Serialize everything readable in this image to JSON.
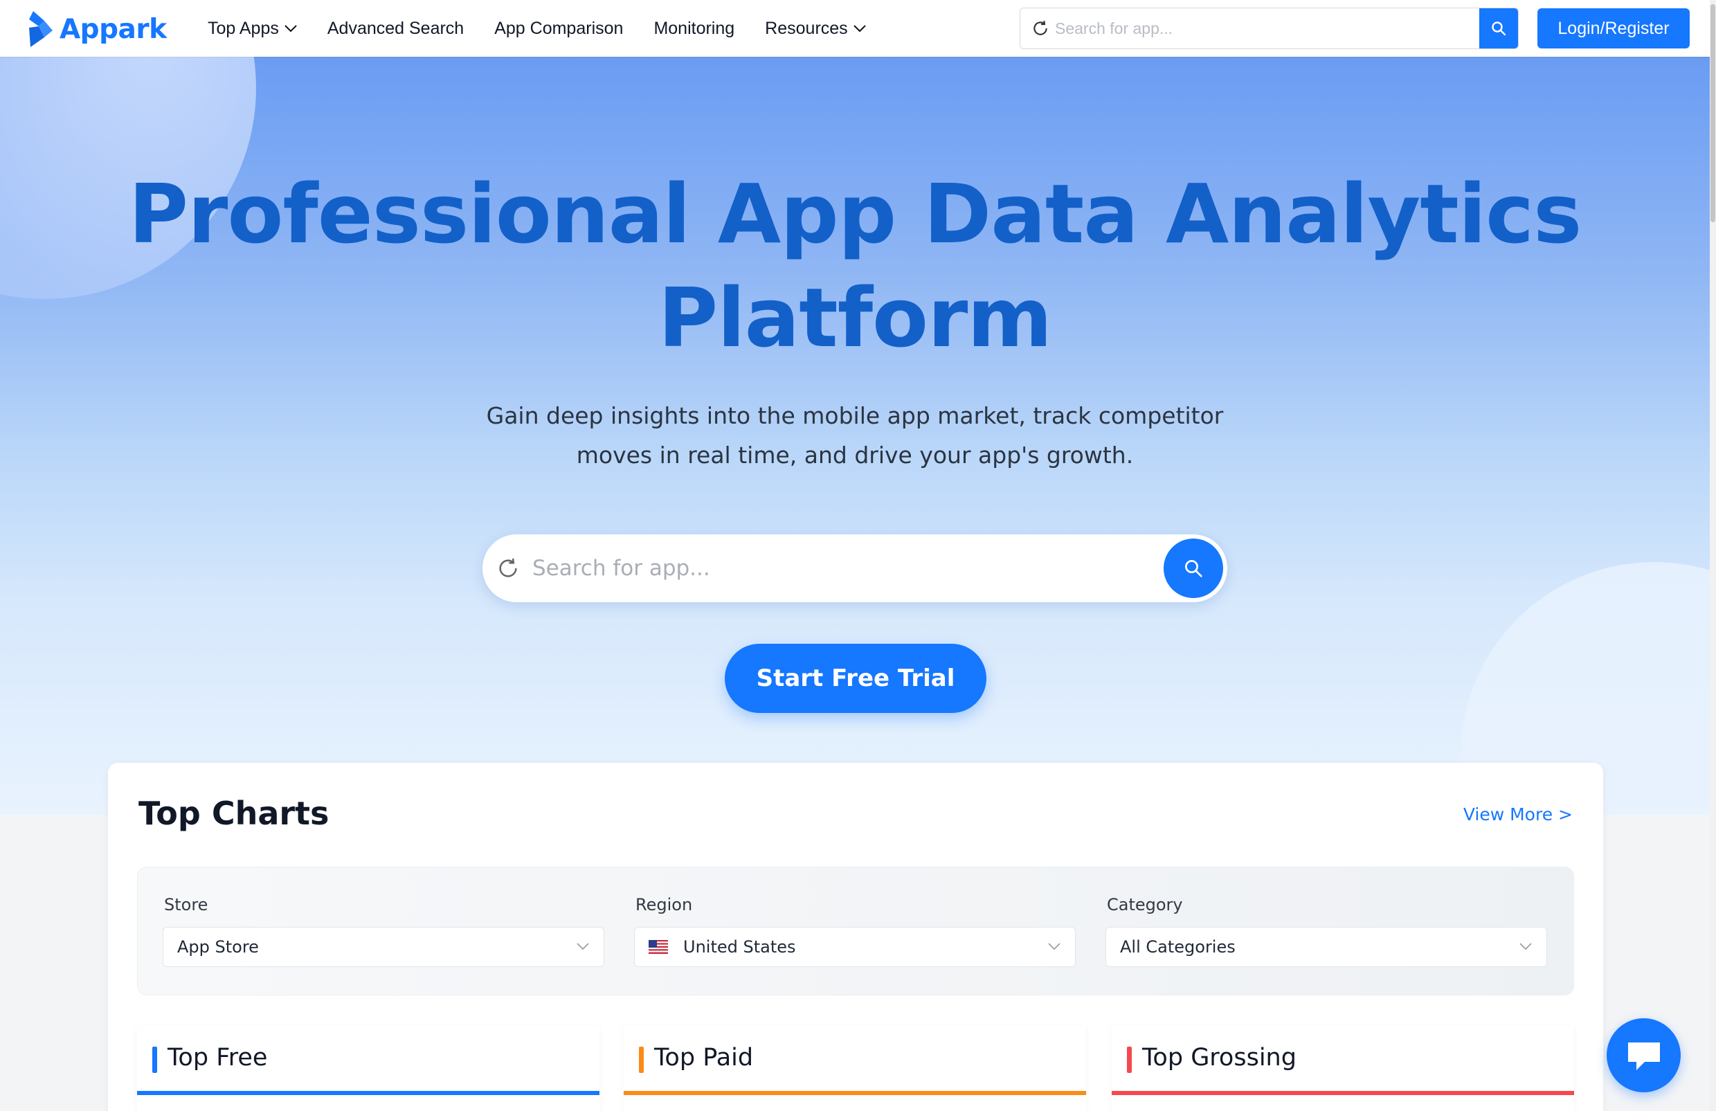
{
  "brand": {
    "name": "Appark",
    "color": "#1677ff"
  },
  "nav": {
    "items": [
      {
        "label": "Top Apps",
        "has_dropdown": true
      },
      {
        "label": "Advanced Search",
        "has_dropdown": false
      },
      {
        "label": "App Comparison",
        "has_dropdown": false
      },
      {
        "label": "Monitoring",
        "has_dropdown": false
      },
      {
        "label": "Resources",
        "has_dropdown": true
      }
    ],
    "search_placeholder": "Search for app...",
    "search_icon": "search-icon",
    "login_label": "Login/Register"
  },
  "hero": {
    "title_line1": "Professional App Data Analytics",
    "title_line2": "Platform",
    "subtitle_line1": "Gain deep insights into the mobile app market, track competitor",
    "subtitle_line2": "moves in real time, and drive your app's growth.",
    "search_placeholder": "Search for app...",
    "cta_label": "Start Free Trial"
  },
  "top_charts": {
    "title": "Top Charts",
    "view_more": "View More >",
    "filters": [
      {
        "label": "Store",
        "value": "App Store"
      },
      {
        "label": "Region",
        "value": "United States",
        "flag": "us-flag-icon"
      },
      {
        "label": "Category",
        "value": "All Categories"
      }
    ],
    "tabs": [
      {
        "label": "Top Free",
        "color": "#1677ff"
      },
      {
        "label": "Top Paid",
        "color": "#fa8c16"
      },
      {
        "label": "Top Grossing",
        "color": "#f5484f"
      }
    ]
  },
  "chat": {
    "icon": "chat-bubble-icon"
  }
}
